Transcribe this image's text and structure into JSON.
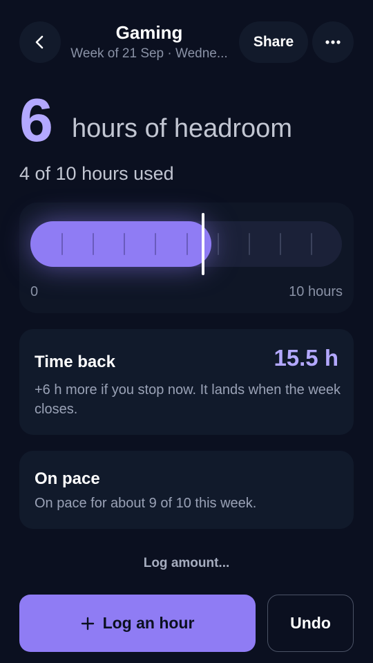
{
  "header": {
    "title": "Gaming",
    "subtitle": "Week of 21 Sep · Wedne...",
    "share_label": "Share",
    "back_icon": "chevron-left-icon",
    "more_icon": "more-horizontal-icon"
  },
  "headroom": {
    "value": "6",
    "label": "hours of headroom",
    "used_text": "4 of 10 hours used"
  },
  "meter": {
    "used": 4,
    "goal": 10,
    "fraction": 0.58,
    "min_label": "0",
    "max_label": "10 hours",
    "ticks": 9
  },
  "time_back": {
    "title": "Time back",
    "value": "15.5 h",
    "body": "+6 h more if you stop now. It lands when the week closes."
  },
  "pace": {
    "title": "On pace",
    "body": "On pace for about 9 of 10 this week."
  },
  "actions": {
    "log_amount": "Log amount...",
    "log_hour": "Log an hour",
    "undo": "Undo",
    "plus_icon": "plus-icon"
  },
  "colors": {
    "accent": "#8f7cf4",
    "accent_text": "#b3a8ff",
    "background": "#0b1020",
    "card": "#111a2b"
  }
}
